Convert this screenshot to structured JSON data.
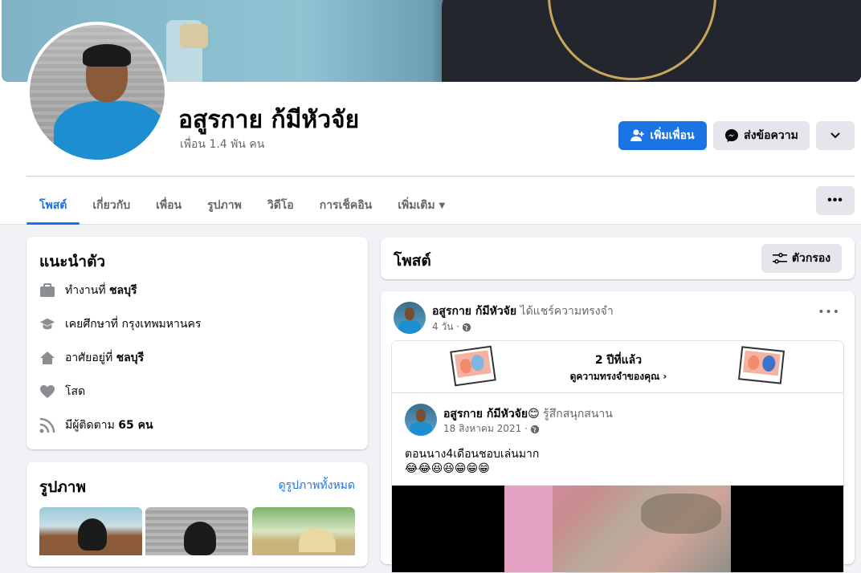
{
  "profile": {
    "name": "อสูรกาย ก้มีหัวจัย",
    "friends": "เพื่อน 1.4 พัน คน"
  },
  "actions": {
    "add_friend": "เพิ่มเพื่อน",
    "message": "ส่งข้อความ"
  },
  "tabs": [
    {
      "label": "โพสต์"
    },
    {
      "label": "เกี่ยวกับ"
    },
    {
      "label": "เพื่อน"
    },
    {
      "label": "รูปภาพ"
    },
    {
      "label": "วิดีโอ"
    },
    {
      "label": "การเช็คอิน"
    },
    {
      "label": "เพิ่มเติม"
    }
  ],
  "intro": {
    "title": "แนะนำตัว",
    "work_prefix": "ทำงานที่ ",
    "work": "ชลบุรี",
    "study": "เคยศึกษาที่ กรุงเทพมหานคร",
    "lives_prefix": "อาศัยอยู่ที่ ",
    "lives": "ชลบุรี",
    "relationship": "โสด",
    "followers_prefix": "มีผู้ติดตาม ",
    "followers": "65 คน"
  },
  "photos": {
    "title": "รูปภาพ",
    "see_all": "ดูรูปภาพทั้งหมด"
  },
  "posts_header": {
    "title": "โพสต์",
    "filter": "ตัวกรอง"
  },
  "post": {
    "author": "อสูรกาย ก้มีหัวจัย",
    "action": "ได้แชร์ความทรงจำ",
    "time": "4 วัน ·",
    "memory": {
      "years": "2 ปีที่แล้ว",
      "see_memories": "ดูความทรงจำของคุณ"
    },
    "shared": {
      "author": "อสูรกาย ก้มีหัวจัย",
      "emoji": "😊",
      "feeling": "รู้สึกสนุกสนาน",
      "date": "18 สิงหาคม 2021 ·",
      "text": "ตอนนาง4เดือนชอบเล่นมาก",
      "emojis": "😂😂😆😆😁😁😁"
    }
  }
}
